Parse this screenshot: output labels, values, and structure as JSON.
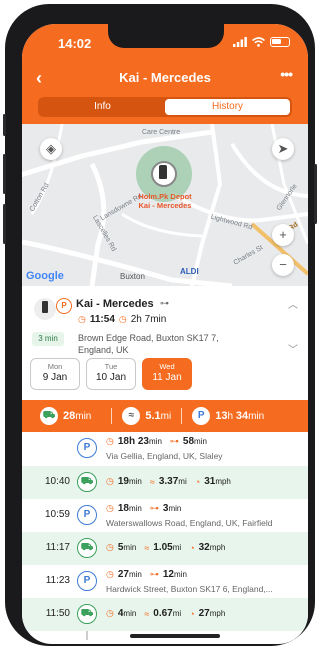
{
  "status": {
    "time": "14:02"
  },
  "nav": {
    "back": "‹",
    "title": "Kai - Mercedes",
    "more": "•••"
  },
  "tabs": [
    {
      "label": "Info"
    },
    {
      "label": "History"
    }
  ],
  "map": {
    "labels": {
      "care_centre": "Care Centre",
      "holm_depot": "Holm.Pk Depot",
      "pin_name": "Kai - Mercedes",
      "cotton_rd": "Cotton Rd",
      "lansdowne": "Lansdowne Rd",
      "lightwood": "Lightwood Rd",
      "lascelles": "Lascelles Rd",
      "buxton": "Buxton",
      "aldi": "ALDI",
      "charles": "Charles St",
      "field_rd": "field Rd",
      "glennorle": "Glennorle",
      "google": "Google"
    },
    "buttons": {
      "layers": "◈",
      "locate": "➤",
      "zoom_in": "+",
      "zoom_out": "−"
    }
  },
  "info": {
    "name": "Kai - Mercedes",
    "start_time": "11:54",
    "duration": "2h 7min",
    "address_line1": "Brown Edge Road, Buxton SK17 7,",
    "address_line2": "England, UK",
    "badge": "3 min",
    "p_badge": "P"
  },
  "days": [
    {
      "dow": "Mon",
      "date": "9 Jan",
      "active": false
    },
    {
      "dow": "Tue",
      "date": "10 Jan",
      "active": false
    },
    {
      "dow": "Wed",
      "date": "11 Jan",
      "active": true
    }
  ],
  "summary": {
    "drive_val": "28",
    "drive_unit": "min",
    "dist_val": "5.1",
    "dist_unit": "mi",
    "park_h": "13",
    "park_h_unit": "h",
    "park_m": "34",
    "park_m_unit": "min"
  },
  "rows": [
    {
      "type": "park",
      "time": "",
      "a_val": "18h 23",
      "a_unit": "min",
      "b_val": "58",
      "b_unit": "min",
      "sub": "Via Gellia, England, UK, Slaley"
    },
    {
      "type": "drive",
      "time": "10:40",
      "a_val": "19",
      "a_unit": "min",
      "dist_val": "3.37",
      "dist_unit": "mi",
      "spd_val": "31",
      "spd_unit": "mph"
    },
    {
      "type": "park",
      "time": "10:59",
      "a_val": "18",
      "a_unit": "min",
      "b_val": "3",
      "b_unit": "min",
      "sub": "Waterswallows Road, England, UK, Fairfield"
    },
    {
      "type": "drive",
      "time": "11:17",
      "a_val": "5",
      "a_unit": "min",
      "dist_val": "1.05",
      "dist_unit": "mi",
      "spd_val": "32",
      "spd_unit": "mph"
    },
    {
      "type": "park",
      "time": "11:23",
      "a_val": "27",
      "a_unit": "min",
      "b_val": "12",
      "b_unit": "min",
      "sub": "Hardwick Street, Buxton SK17 6, England,..."
    },
    {
      "type": "drive",
      "time": "11:50",
      "a_val": "4",
      "a_unit": "min",
      "dist_val": "0.67",
      "dist_unit": "mi",
      "spd_val": "27",
      "spd_unit": "mph"
    }
  ],
  "colors": {
    "brand": "#f56b1f",
    "drive": "#3aa05c",
    "park": "#3d7bd6"
  }
}
